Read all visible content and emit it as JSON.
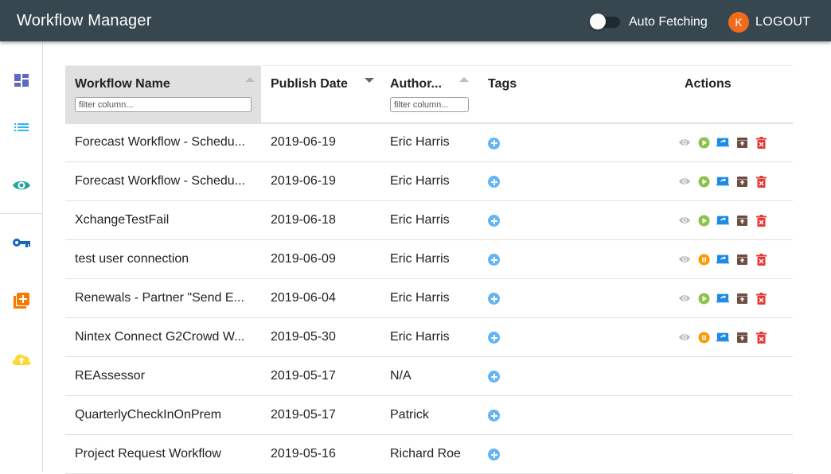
{
  "app": {
    "title": "Workflow Manager"
  },
  "header": {
    "auto_fetching_label": "Auto Fetching",
    "avatar_initial": "K",
    "logout_label": "LOGOUT"
  },
  "sidebar": {
    "items": [
      {
        "icon": "dashboard-icon",
        "color": "#5c6bc0"
      },
      {
        "icon": "list-icon",
        "color": "#29b6f6"
      },
      {
        "icon": "eye-icon",
        "color": "#26a69a"
      },
      {
        "icon": "key-icon",
        "color": "#1565c0"
      },
      {
        "icon": "add-library-icon",
        "color": "#f57c00"
      },
      {
        "icon": "cloud-upload-icon",
        "color": "#fdd835"
      }
    ]
  },
  "table": {
    "columns": {
      "name": "Workflow Name",
      "date": "Publish Date",
      "author": "Author...",
      "tags": "Tags",
      "actions": "Actions"
    },
    "filter_placeholder": "filter column...",
    "rows": [
      {
        "name": "Forecast Workflow - Schedu...",
        "date": "2019-06-19",
        "author": "Eric Harris",
        "state": "play"
      },
      {
        "name": "Forecast Workflow - Schedu...",
        "date": "2019-06-19",
        "author": "Eric Harris",
        "state": "play"
      },
      {
        "name": "XchangeTestFail",
        "date": "2019-06-18",
        "author": "Eric Harris",
        "state": "play"
      },
      {
        "name": "test user connection",
        "date": "2019-06-09",
        "author": "Eric Harris",
        "state": "pause"
      },
      {
        "name": "Renewals - Partner \"Send E...",
        "date": "2019-06-04",
        "author": "Eric Harris",
        "state": "play"
      },
      {
        "name": "Nintex Connect G2Crowd W...",
        "date": "2019-05-30",
        "author": "Eric Harris",
        "state": "pause"
      },
      {
        "name": "REAssessor",
        "date": "2019-05-17",
        "author": "N/A",
        "state": "none"
      },
      {
        "name": "QuarterlyCheckInOnPrem",
        "date": "2019-05-17",
        "author": "Patrick",
        "state": "none"
      },
      {
        "name": "Project Request Workflow",
        "date": "2019-05-16",
        "author": "Richard Roe",
        "state": "none"
      }
    ]
  },
  "colors": {
    "appbar": "#37474f",
    "play": "#8bc34a",
    "pause": "#ff9800",
    "publish": "#1e88e5",
    "archive": "#6d4c41",
    "delete": "#e53935",
    "view": "#bdbdbd",
    "tag": "#64b5f6"
  }
}
